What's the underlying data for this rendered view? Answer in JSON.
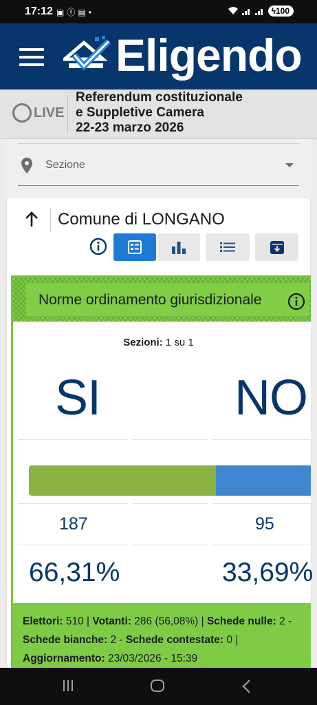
{
  "status_bar": {
    "time": "17:12",
    "left_icons": [
      "screenshot-icon",
      "facebook-icon",
      "news-icon",
      "dot-icon"
    ],
    "battery": "100"
  },
  "app": {
    "logo_text": "Eligendo",
    "live_label": "LIVE",
    "event_title_lines": [
      "Referendum costituzionale",
      "e Suppletive Camera",
      "22-23 marzo 2026"
    ]
  },
  "filter": {
    "select_label": "Sezione"
  },
  "location": {
    "title": "Comune di LONGANO"
  },
  "toolbar": {
    "buttons": [
      "table-view",
      "chart-view",
      "list-view",
      "download"
    ],
    "active": "table-view"
  },
  "question": {
    "title": "Norme ordinamento giurisdizionale",
    "sezioni_label": "Sezioni:",
    "sezioni_value": "1 su 1",
    "yes_label": "SI",
    "no_label": "NO",
    "yes_votes": "187",
    "no_votes": "95",
    "yes_percent_text": "66,31%",
    "no_percent_text": "33,69%",
    "yes_share": 0.6631,
    "no_share": 0.3369,
    "colors": {
      "yes": "#8ab342",
      "no": "#3f86cf",
      "highlight": "#7ecc45"
    }
  },
  "stats": {
    "elettori_label": "Elettori:",
    "elettori_value": "510 |",
    "votanti_label": "Votanti:",
    "votanti_value": "286 (56,08%) |",
    "nulle_label": "Schede nulle:",
    "nulle_value": "2 -",
    "bianche_label": "Schede bianche:",
    "bianche_value": "2 -",
    "contestate_label": "Schede contestate:",
    "contestate_value": "0 |",
    "aggiornamento_label": "Aggiornamento:",
    "aggiornamento_value": "23/03/2026 - 15:39"
  }
}
